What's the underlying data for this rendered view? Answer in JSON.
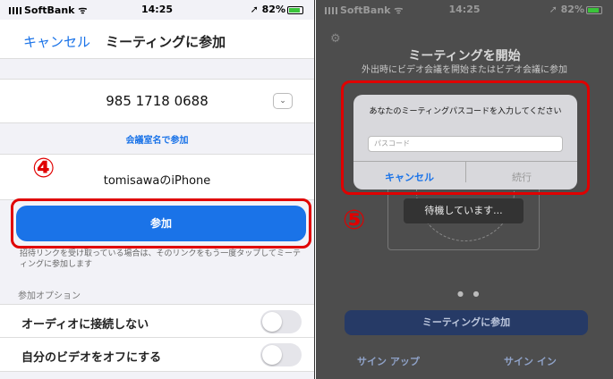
{
  "left_screen": {
    "status": {
      "carrier": "SoftBank",
      "time": "14:25",
      "battery": "82%"
    },
    "nav": {
      "cancel_label": "キャンセル",
      "title": "ミーティングに参加"
    },
    "meeting_id": "985 1718 0688",
    "room_join_link": "会議室名で参加",
    "device_name": "tomisawaのiPhone",
    "step_marker": "④",
    "join_button": "参加",
    "hint_text": "招待リンクを受け取っている場合は、そのリンクをもう一度タップしてミーティングに参加します",
    "options_header": "参加オプション",
    "options": [
      {
        "label": "オーディオに接続しない",
        "enabled": false
      },
      {
        "label": "自分のビデオをオフにする",
        "enabled": false
      }
    ]
  },
  "right_screen": {
    "status": {
      "carrier": "SoftBank",
      "time": "14:25",
      "battery": "82%"
    },
    "title": "ミーティングを開始",
    "subtitle": "外出時にビデオ会議を開始またはビデオ会議に参加",
    "dialog": {
      "message": "あなたのミーティングパスコードを入力してください",
      "passcode_placeholder": "パスコード",
      "cancel_label": "キャンセル",
      "continue_label": "続行"
    },
    "waiting_text": "待機しています...",
    "step_marker": "⑤",
    "join_meeting_button": "ミーティングに参加",
    "sign_up_label": "サイン アップ",
    "sign_in_label": "サイン イン"
  },
  "colors": {
    "accent_blue": "#1a73e8",
    "highlight_red": "#e00000",
    "dark_join": "#263a66"
  }
}
